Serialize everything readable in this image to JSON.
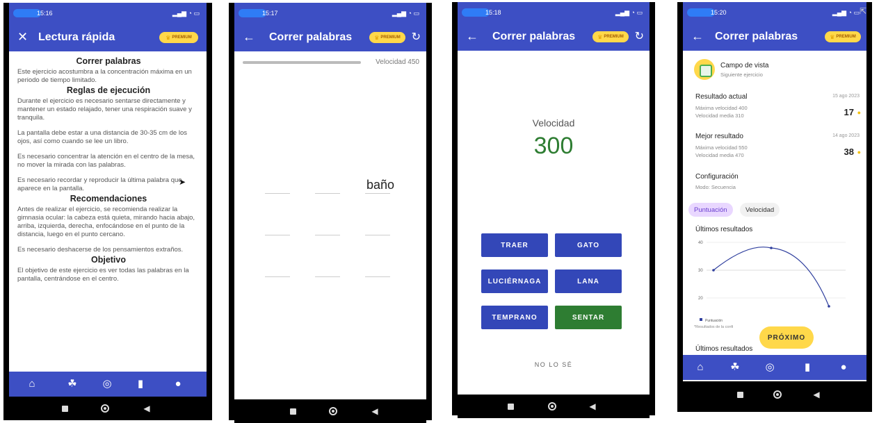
{
  "premium_label": "PREMIUM",
  "phone1": {
    "status_time": "15:16",
    "title": "Lectura rápida",
    "sections": [
      {
        "heading": "Correr palabras",
        "paragraphs": [
          "Este ejercicio acostumbra a la concentración máxima en un periodo de tiempo limitado."
        ]
      },
      {
        "heading": "Reglas de ejecución",
        "paragraphs": [
          "Durante el ejercicio es necesario sentarse directamente y mantener un estado relajado, tener una respiración suave y tranquila.",
          "La pantalla debe estar a una distancia de 30-35 cm de los ojos, así como cuando se lee un libro.",
          "Es necesario concentrar la atención en el centro de la mesa, no mover la mirada con las palabras.",
          "Es necesario recordar y reproducir la última palabra que aparece en la pantalla."
        ]
      },
      {
        "heading": "Recomendaciones",
        "paragraphs": [
          "Antes de realizar el ejercicio, se recomienda realizar la gimnasia ocular: la cabeza está quieta, mirando hacia abajo, arriba, izquierda, derecha, enfocándose en el punto de la distancia, luego en el punto cercano.",
          "Es necesario deshacerse de los pensamientos extraños."
        ]
      },
      {
        "heading": "Objetivo",
        "paragraphs": [
          "El objetivo de este ejercicio es ver todas las palabras en la pantalla, centrándose en el centro."
        ]
      }
    ]
  },
  "phone2": {
    "status_time": "15:17",
    "title": "Correr palabras",
    "speed_label": "Velocidad 450",
    "shown_word": "baño"
  },
  "phone3": {
    "status_time": "15:18",
    "title": "Correr palabras",
    "speed_label": "Velocidad",
    "speed_value": "300",
    "answers": [
      "TRAER",
      "GATO",
      "LUCIÉRNAGA",
      "LANA",
      "TEMPRANO",
      "SENTAR"
    ],
    "dont_know": "NO LO SÉ"
  },
  "phone4": {
    "status_time": "15:20",
    "title": "Correr palabras",
    "next_exercise": {
      "name": "Campo de vista",
      "subtitle": "Siguiente ejercicio"
    },
    "current": {
      "label": "Resultado actual",
      "date": "15 ago 2023",
      "max": "Máxima velocidad 400",
      "avg": "Velocidad media 310",
      "score": "17"
    },
    "best": {
      "label": "Mejor resultado",
      "date": "14 ago 2023",
      "max": "Máxima velocidad 550",
      "avg": "Velocidad media 470",
      "score": "38"
    },
    "config": {
      "label": "Configuración",
      "mode": "Modo: Secuencia"
    },
    "chips": [
      "Puntuación",
      "Velocidad"
    ],
    "chart_heading": "Últimos resultados",
    "footnote": "*Resultados de la confi",
    "next_button": "PRÓXIMO",
    "bottom_heading": "Últimos resultados",
    "chart_data": {
      "type": "line",
      "x": [
        1,
        2,
        3
      ],
      "series": [
        {
          "name": "Puntuación",
          "values": [
            30,
            38,
            17
          ]
        }
      ],
      "yticks": [
        "40",
        "30",
        "20"
      ],
      "ylim": [
        15,
        42
      ],
      "grid": true,
      "legend": "bottom-left"
    }
  },
  "colors": {
    "primary": "#3d4fc4",
    "answer": "#3347b8",
    "correct": "#2e7d32",
    "premium": "#ffd84a"
  }
}
